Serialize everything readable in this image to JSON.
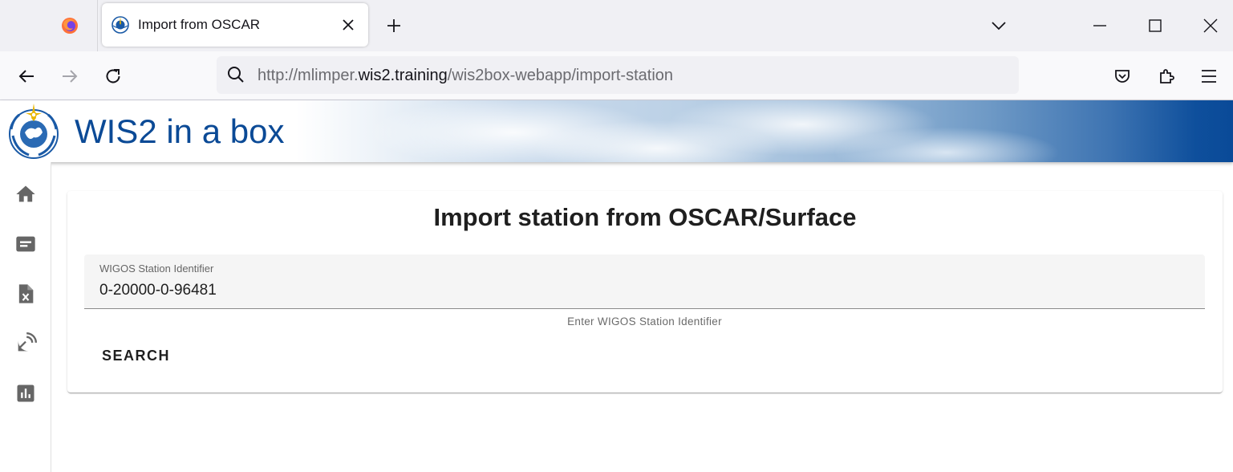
{
  "browser": {
    "tab_title": "Import from OSCAR",
    "url_prefix": "http://mlimper.",
    "url_domain": "wis2.training",
    "url_path": "/wis2box-webapp/import-station",
    "icons": {
      "browser_logo": "firefox-icon",
      "tab_favicon": "wmo-favicon-icon",
      "close_tab": "close-icon",
      "new_tab": "plus-icon",
      "list_tabs": "chevron-down-icon",
      "minimize": "minimize-icon",
      "maximize": "maximize-icon",
      "close_window": "close-window-icon",
      "back": "back-arrow-icon",
      "forward": "forward-arrow-icon",
      "reload": "reload-icon",
      "url_search": "search-icon",
      "pocket": "pocket-icon",
      "extensions": "extensions-icon",
      "menu": "hamburger-menu-icon"
    }
  },
  "app": {
    "title": "WIS2 in a box",
    "brand_color": "#0b4a96"
  },
  "sidebar": {
    "items": [
      {
        "icon": "home-icon"
      },
      {
        "icon": "message-icon"
      },
      {
        "icon": "csv-file-icon"
      },
      {
        "icon": "satellite-dish-icon"
      },
      {
        "icon": "bar-chart-icon"
      }
    ]
  },
  "main": {
    "heading": "Import station from OSCAR/Surface",
    "wigos_field": {
      "label": "WIGOS Station Identifier",
      "value": "0-20000-0-96481",
      "hint": "Enter WIGOS Station Identifier"
    },
    "search_button": "SEARCH"
  }
}
